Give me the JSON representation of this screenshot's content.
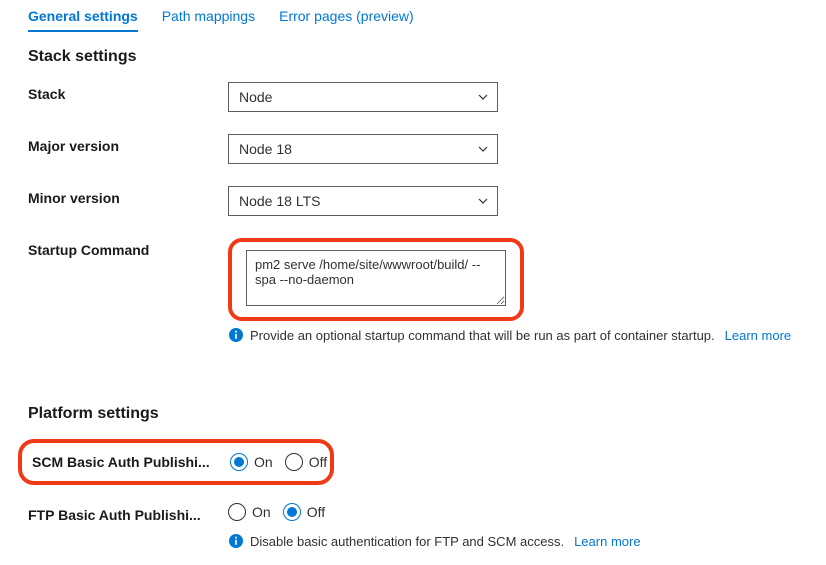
{
  "tabs": {
    "general": "General settings",
    "path": "Path mappings",
    "error": "Error pages (preview)"
  },
  "stack_section": {
    "title": "Stack settings",
    "stack": {
      "label": "Stack",
      "value": "Node"
    },
    "major": {
      "label": "Major version",
      "value": "Node 18"
    },
    "minor": {
      "label": "Minor version",
      "value": "Node 18 LTS"
    },
    "startup": {
      "label": "Startup Command",
      "value": "pm2 serve /home/site/wwwroot/build/ --spa --no-daemon"
    },
    "info": "Provide an optional startup command that will be run as part of container startup.",
    "learn_more": "Learn more"
  },
  "platform_section": {
    "title": "Platform settings",
    "scm": {
      "label": "SCM Basic Auth Publishi...",
      "on": "On",
      "off": "Off",
      "selected": "on"
    },
    "ftp": {
      "label": "FTP Basic Auth Publishi...",
      "on": "On",
      "off": "Off",
      "selected": "off"
    },
    "info": "Disable basic authentication for FTP and SCM access.",
    "learn_more": "Learn more"
  }
}
